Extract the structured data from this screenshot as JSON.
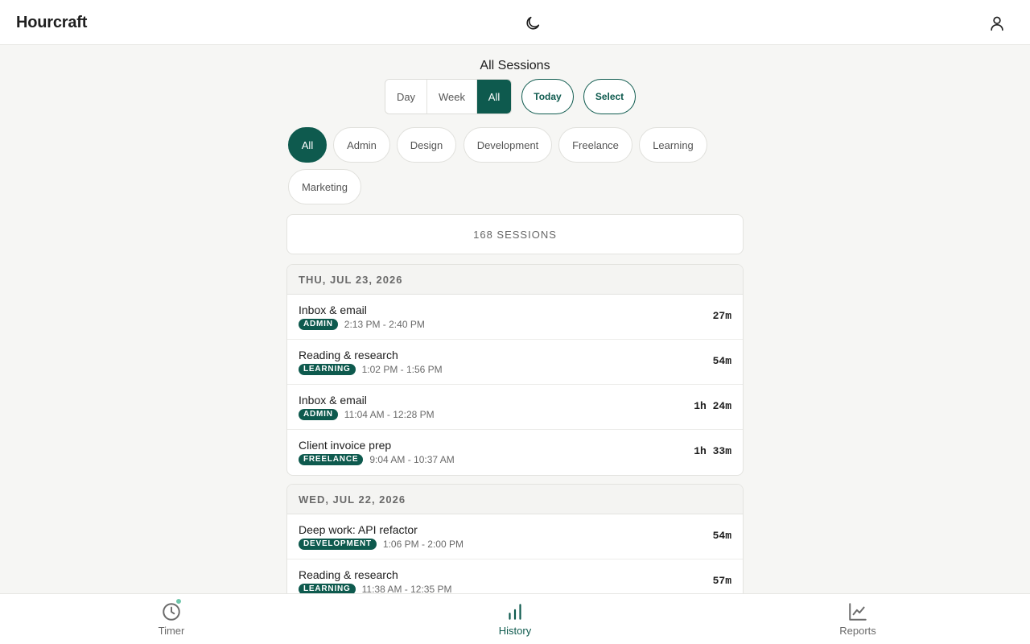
{
  "app": {
    "name": "Hourcraft"
  },
  "header": {
    "theme_icon": "moon-icon",
    "account_icon": "user-icon"
  },
  "page": {
    "title": "All Sessions"
  },
  "range": {
    "options": [
      "Day",
      "Week",
      "All"
    ],
    "selected": "All",
    "today_label": "Today",
    "select_label": "Select"
  },
  "filters": {
    "chips": [
      "All",
      "Admin",
      "Design",
      "Development",
      "Freelance",
      "Learning",
      "Marketing"
    ],
    "selected": "All"
  },
  "summary": {
    "count_label": "168 SESSIONS"
  },
  "days": [
    {
      "date": "THU, JUL 23, 2026",
      "sessions": [
        {
          "title": "Inbox & email",
          "tag": "ADMIN",
          "time": "2:13 PM - 2:40 PM",
          "duration": "27m"
        },
        {
          "title": "Reading & research",
          "tag": "LEARNING",
          "time": "1:02 PM - 1:56 PM",
          "duration": "54m"
        },
        {
          "title": "Inbox & email",
          "tag": "ADMIN",
          "time": "11:04 AM - 12:28 PM",
          "duration": "1h 24m"
        },
        {
          "title": "Client invoice prep",
          "tag": "FREELANCE",
          "time": "9:04 AM - 10:37 AM",
          "duration": "1h 33m"
        }
      ]
    },
    {
      "date": "WED, JUL 22, 2026",
      "sessions": [
        {
          "title": "Deep work: API refactor",
          "tag": "DEVELOPMENT",
          "time": "1:06 PM - 2:00 PM",
          "duration": "54m"
        },
        {
          "title": "Reading & research",
          "tag": "LEARNING",
          "time": "11:38 AM - 12:35 PM",
          "duration": "57m"
        }
      ]
    }
  ],
  "nav": {
    "items": [
      {
        "label": "Timer",
        "icon": "clock-icon",
        "badge": true
      },
      {
        "label": "History",
        "icon": "bar-chart-icon",
        "active": true
      },
      {
        "label": "Reports",
        "icon": "line-chart-icon"
      }
    ]
  },
  "colors": {
    "accent": "#0e5a4e",
    "badge": "#6fc7ac",
    "background": "#f6f6f4"
  }
}
